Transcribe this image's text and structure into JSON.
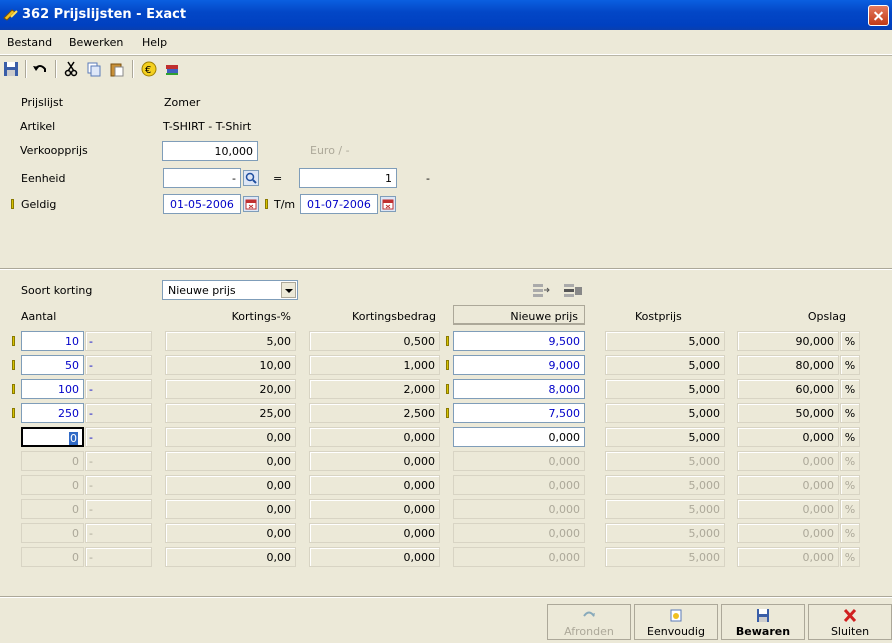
{
  "window": {
    "title": "362 Prijslijsten - Exact"
  },
  "menu": [
    "Bestand",
    "Bewerken",
    "Help"
  ],
  "toolbar": {
    "icons": [
      "save-icon",
      "undo-icon",
      "cut-icon",
      "copy-icon",
      "paste-icon",
      "euro-icon",
      "books-icon"
    ]
  },
  "header": {
    "prijslijst_label": "Prijslijst",
    "prijslijst_value": "Zomer",
    "artikel_label": "Artikel",
    "artikel_value": "T-SHIRT - T-Shirt",
    "verkoopprijs_label": "Verkoopprijs",
    "verkoopprijs_value": "10,000",
    "currency": "Euro / -",
    "eenheid_label": "Eenheid",
    "eenheid_value": "-",
    "eq": "=",
    "eenheid_factor": "1",
    "eenheid_suffix": "-",
    "geldig_label": "Geldig",
    "geldig_from": "01-05-2006",
    "tm_label": "T/m",
    "geldig_to": "01-07-2006"
  },
  "discount": {
    "soort_label": "Soort korting",
    "soort_value": "Nieuwe prijs",
    "headers": {
      "aantal": "Aantal",
      "kortings_pct": "Kortings-%",
      "kortingsbedrag": "Kortingsbedrag",
      "nieuwe_prijs": "Nieuwe prijs",
      "kostprijs": "Kostprijs",
      "opslag": "Opslag"
    },
    "rows": [
      {
        "aantal": "10",
        "unit": "-",
        "pct": "5,00",
        "bedrag": "0,500",
        "prijs": "9,500",
        "kost": "5,000",
        "opslag": "90,000",
        "sign": "%"
      },
      {
        "aantal": "50",
        "unit": "-",
        "pct": "10,00",
        "bedrag": "1,000",
        "prijs": "9,000",
        "kost": "5,000",
        "opslag": "80,000",
        "sign": "%"
      },
      {
        "aantal": "100",
        "unit": "-",
        "pct": "20,00",
        "bedrag": "2,000",
        "prijs": "8,000",
        "kost": "5,000",
        "opslag": "60,000",
        "sign": "%"
      },
      {
        "aantal": "250",
        "unit": "-",
        "pct": "25,00",
        "bedrag": "2,500",
        "prijs": "7,500",
        "kost": "5,000",
        "opslag": "50,000",
        "sign": "%"
      },
      {
        "aantal": "0",
        "unit": "-",
        "pct": "0,00",
        "bedrag": "0,000",
        "prijs": "0,000",
        "kost": "5,000",
        "opslag": "0,000",
        "sign": "%"
      },
      {
        "aantal": "0",
        "unit": "-",
        "pct": "0,00",
        "bedrag": "0,000",
        "prijs": "0,000",
        "kost": "5,000",
        "opslag": "0,000",
        "sign": "%"
      },
      {
        "aantal": "0",
        "unit": "-",
        "pct": "0,00",
        "bedrag": "0,000",
        "prijs": "0,000",
        "kost": "5,000",
        "opslag": "0,000",
        "sign": "%"
      },
      {
        "aantal": "0",
        "unit": "-",
        "pct": "0,00",
        "bedrag": "0,000",
        "prijs": "0,000",
        "kost": "5,000",
        "opslag": "0,000",
        "sign": "%"
      },
      {
        "aantal": "0",
        "unit": "-",
        "pct": "0,00",
        "bedrag": "0,000",
        "prijs": "0,000",
        "kost": "5,000",
        "opslag": "0,000",
        "sign": "%"
      },
      {
        "aantal": "0",
        "unit": "-",
        "pct": "0,00",
        "bedrag": "0,000",
        "prijs": "0,000",
        "kost": "5,000",
        "opslag": "0,000",
        "sign": "%"
      }
    ]
  },
  "buttons": {
    "afronden": "Afronden",
    "eenvoudig": "Eenvoudig",
    "bewaren": "Bewaren",
    "sluiten": "Sluiten"
  }
}
